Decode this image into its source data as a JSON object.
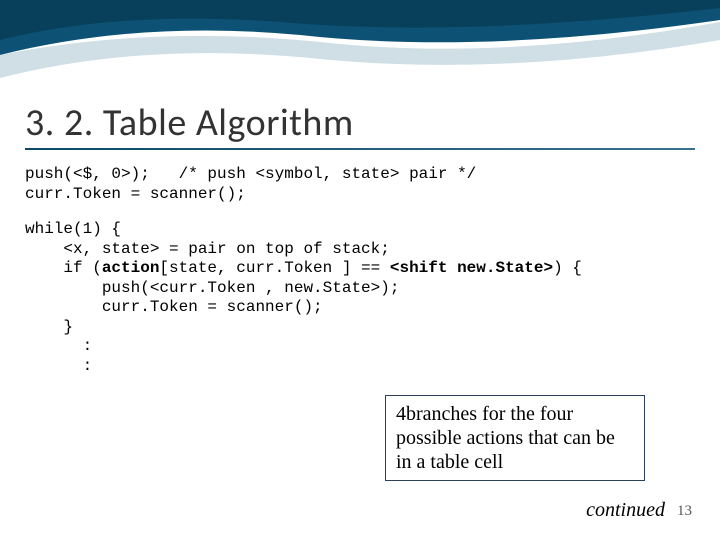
{
  "title": "3. 2.  Table Algorithm",
  "code1": {
    "l1_a": "push(<$, 0>);   /* push <symbol, state> pair */",
    "l2": "curr.Token = scanner();"
  },
  "code2": {
    "l1": "while(1) {",
    "l2": "    <x, state> = pair on top of stack;",
    "l3_a": "    if (",
    "l3_b": "action",
    "l3_c": "[state, curr.Token ] == ",
    "l3_d": "<shift new.State>",
    "l3_e": ") {",
    "l4": "        push(<curr.Token , new.State>);",
    "l5": "        curr.Token = scanner();",
    "l6": "    }",
    "l7": "      :",
    "l8": "      :"
  },
  "callout_pre": " 4",
  "callout": "branches for the four possible actions that can be in a table cell",
  "continued": "continued",
  "page": "13"
}
